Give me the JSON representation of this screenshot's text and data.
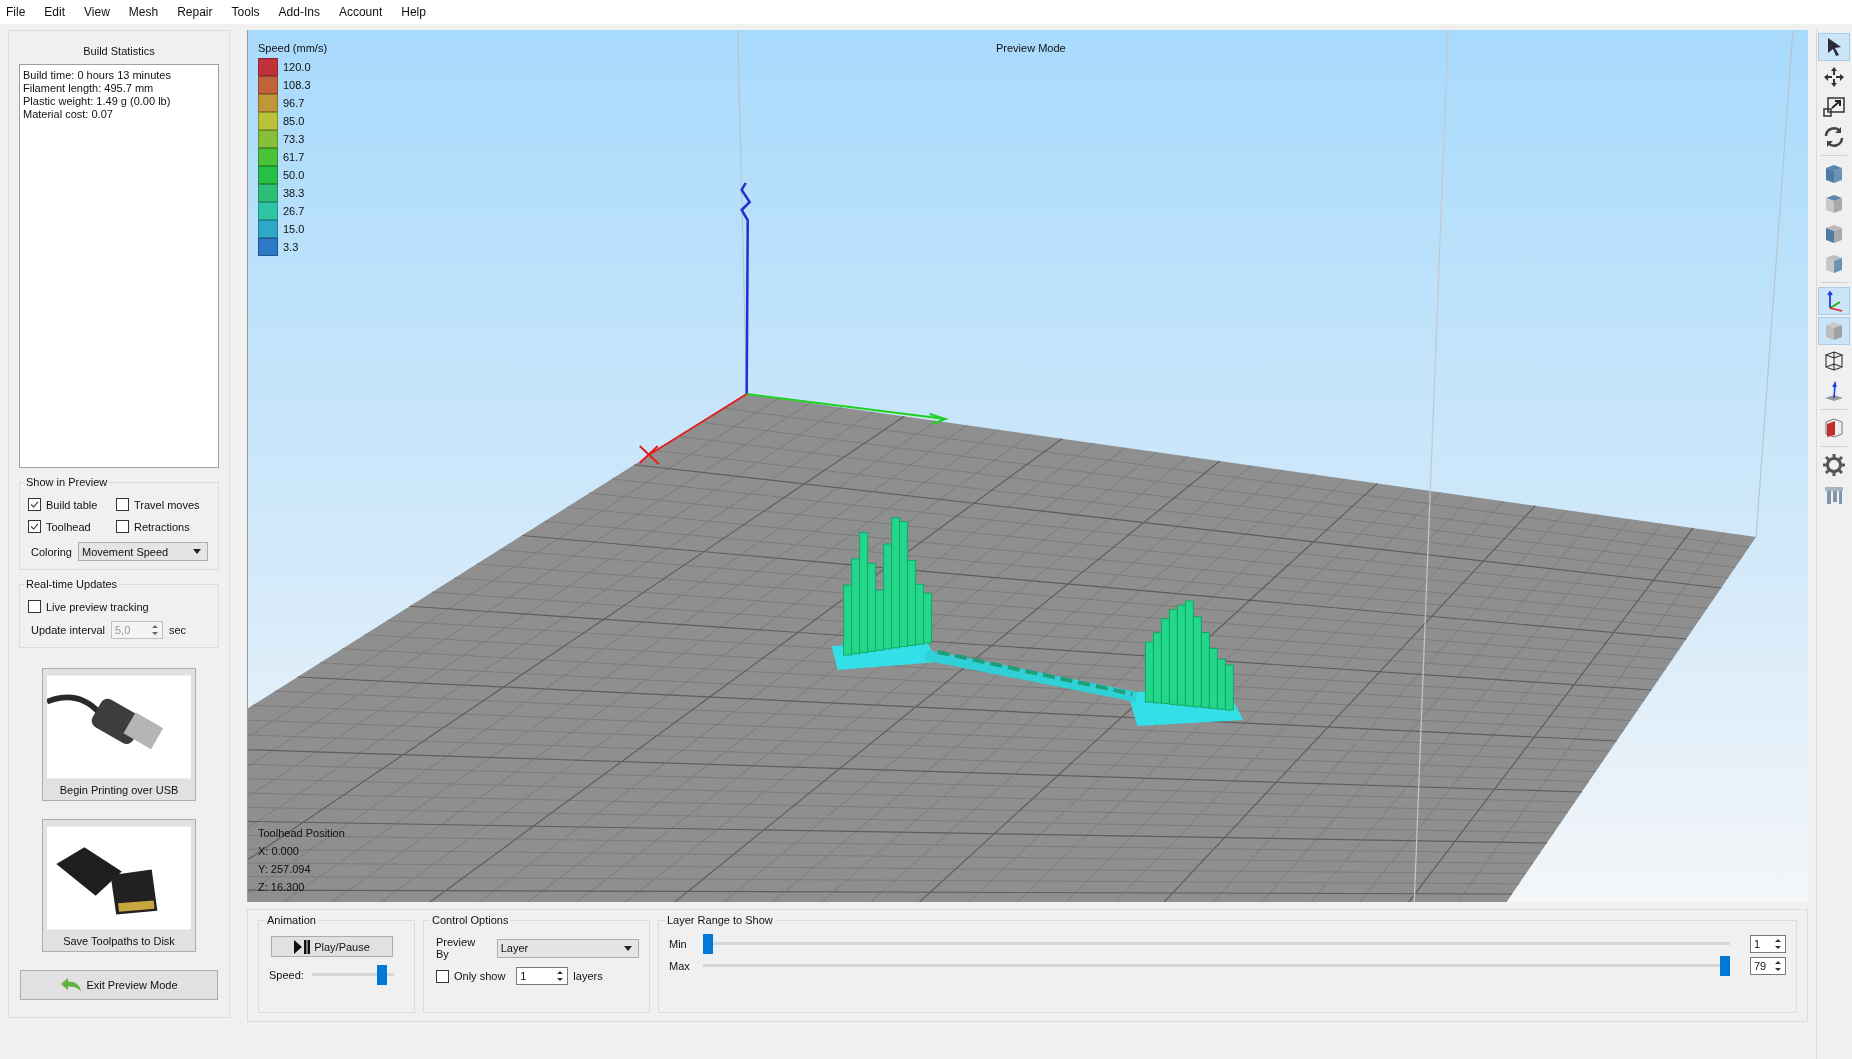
{
  "menu": [
    "File",
    "Edit",
    "View",
    "Mesh",
    "Repair",
    "Tools",
    "Add-Ins",
    "Account",
    "Help"
  ],
  "build_statistics": {
    "title": "Build Statistics",
    "lines": [
      "Build time: 0 hours 13 minutes",
      "Filament length: 495.7 mm",
      "Plastic weight: 1.49 g (0.00 lb)",
      "Material cost: 0.07"
    ]
  },
  "show_in_preview": {
    "title": "Show in Preview",
    "checkboxes": [
      {
        "label": "Build table",
        "checked": true
      },
      {
        "label": "Travel moves",
        "checked": false
      },
      {
        "label": "Toolhead",
        "checked": true
      },
      {
        "label": "Retractions",
        "checked": false
      }
    ],
    "coloring_label": "Coloring",
    "coloring_value": "Movement Speed"
  },
  "realtime_updates": {
    "title": "Real-time Updates",
    "live_tracking": {
      "label": "Live preview tracking",
      "checked": false
    },
    "interval_label": "Update interval",
    "interval_value": "5,0",
    "interval_disabled": true,
    "interval_unit": "sec"
  },
  "actions": [
    {
      "kind": "usb",
      "label": "Begin Printing over USB"
    },
    {
      "kind": "sd",
      "label": "Save Toolpaths to Disk"
    }
  ],
  "exit_button": "Exit Preview Mode",
  "viewport": {
    "mode_label": "Preview Mode",
    "legend": {
      "title": "Speed (mm/s)",
      "entries": [
        {
          "label": "120.0",
          "color": "#c0323a"
        },
        {
          "label": "108.3",
          "color": "#c0623a"
        },
        {
          "label": "96.7",
          "color": "#c09638"
        },
        {
          "label": "85.0",
          "color": "#b9c23a"
        },
        {
          "label": "73.3",
          "color": "#86c03a"
        },
        {
          "label": "61.7",
          "color": "#4ac23a"
        },
        {
          "label": "50.0",
          "color": "#28c046"
        },
        {
          "label": "38.3",
          "color": "#2ebe78"
        },
        {
          "label": "26.7",
          "color": "#2ec4a6"
        },
        {
          "label": "15.0",
          "color": "#2ea8c8"
        },
        {
          "label": "3.3",
          "color": "#2e78c8"
        }
      ]
    },
    "toolhead": {
      "title": "Toolhead Position",
      "lines": [
        "X: 0.000",
        "Y: 257.094",
        "Z: 16.300"
      ]
    }
  },
  "animation": {
    "title": "Animation",
    "play_button": "Play/Pause",
    "speed": {
      "label": "Speed:",
      "level": 0.9
    }
  },
  "control_options": {
    "title": "Control Options",
    "preview_by_label": "Preview By",
    "preview_by_value": "Layer",
    "only_show": {
      "label": "Only show",
      "checked": false
    },
    "count": "1",
    "unit": "layers"
  },
  "layer_range": {
    "title": "Layer Range to Show",
    "sliders": [
      {
        "label": "Min",
        "level": 0,
        "value": "1"
      },
      {
        "label": "Max",
        "level": 1,
        "value": "79"
      }
    ]
  },
  "toolbar": [
    [
      {
        "kind": "select",
        "selected": true
      },
      {
        "kind": "move",
        "selected": false
      },
      {
        "kind": "scale",
        "selected": false
      },
      {
        "kind": "rotate",
        "selected": false
      }
    ],
    [
      {
        "kind": "view-iso",
        "selected": false
      },
      {
        "kind": "view-top",
        "selected": false
      },
      {
        "kind": "view-front",
        "selected": false
      },
      {
        "kind": "view-side",
        "selected": false
      }
    ],
    [
      {
        "kind": "axes",
        "selected": true
      },
      {
        "kind": "solid",
        "selected": true
      },
      {
        "kind": "wireframe",
        "selected": false
      },
      {
        "kind": "normals",
        "selected": false
      }
    ],
    [
      {
        "kind": "section",
        "selected": false
      }
    ],
    [
      {
        "kind": "settings",
        "selected": false
      },
      {
        "kind": "supports",
        "selected": false
      }
    ]
  ]
}
